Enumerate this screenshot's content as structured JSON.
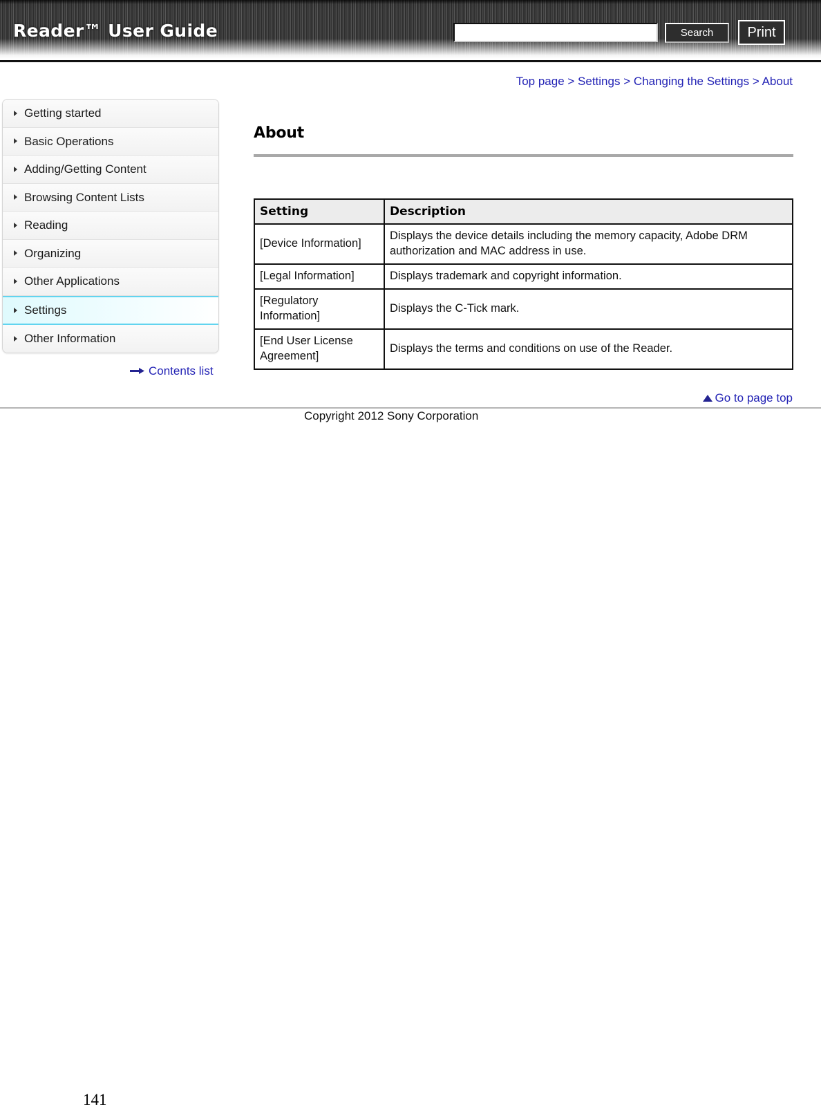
{
  "header": {
    "title": "Reader™ User Guide",
    "search_value": "",
    "search_placeholder": "",
    "search_button_label": "Search",
    "print_button_label": "Print"
  },
  "breadcrumb": {
    "text": "Top page > Settings > Changing the Settings > About"
  },
  "sidebar": {
    "items": [
      {
        "label": "Getting started",
        "active": false
      },
      {
        "label": "Basic Operations",
        "active": false
      },
      {
        "label": "Adding/Getting Content",
        "active": false
      },
      {
        "label": "Browsing Content Lists",
        "active": false
      },
      {
        "label": "Reading",
        "active": false
      },
      {
        "label": "Organizing",
        "active": false
      },
      {
        "label": "Other Applications",
        "active": false
      },
      {
        "label": "Settings",
        "active": true
      },
      {
        "label": "Other Information",
        "active": false
      }
    ],
    "contents_list_label": "Contents list"
  },
  "main": {
    "heading": "About",
    "table": {
      "columns": [
        "Setting",
        "Description"
      ],
      "rows": [
        {
          "setting": "[Device Information]",
          "description": "Displays the device details including the memory capacity, Adobe DRM authorization and MAC address in use."
        },
        {
          "setting": "[Legal Information]",
          "description": "Displays trademark and copyright information."
        },
        {
          "setting": "[Regulatory Information]",
          "description": "Displays the C-Tick mark."
        },
        {
          "setting": "[End User License Agreement]",
          "description": "Displays the terms and conditions on use of the Reader."
        }
      ]
    }
  },
  "footer": {
    "go_to_top_label": "Go to page top",
    "copyright": "Copyright 2012 Sony Corporation",
    "page_number": "141"
  },
  "colors": {
    "link": "#2323b5",
    "accent_highlight": "#62d4ef",
    "header_bg": "#3a3a3a",
    "rule": "#a8a8a8"
  }
}
